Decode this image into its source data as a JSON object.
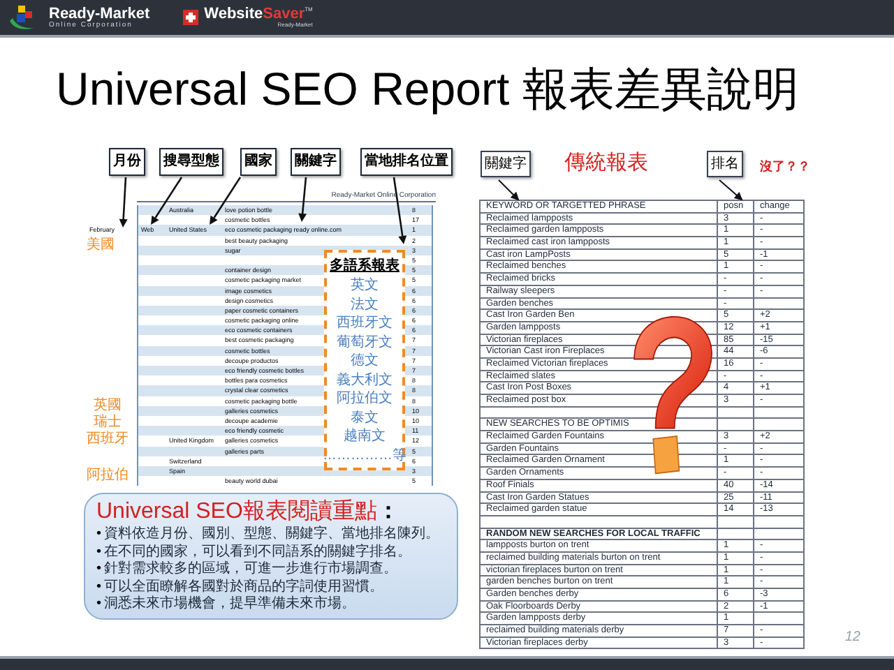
{
  "header": {
    "logos": [
      {
        "kind": "ready",
        "name": "Ready-Market",
        "subtext": "Online Corporation"
      },
      {
        "kind": "saver",
        "name": "Website",
        "accent": "Saver",
        "subtext": "Ready-Market",
        "mark": "TM"
      }
    ]
  },
  "title": "Universal SEO Report 報表差異說明",
  "left": {
    "labels": [
      "月份",
      "搜尋型態",
      "國家",
      "關鍵字",
      "當地排名位置"
    ],
    "report": {
      "company": "Ready-Market Online Corporation",
      "rows": [
        {
          "country": "Australia",
          "keyword": "love potion bottle",
          "rank": "8"
        },
        {
          "keyword": "cosmetic bottles",
          "rank": "17"
        },
        {
          "month": "February",
          "type": "Web",
          "country": "United States",
          "keyword": "eco cosmetic packaging ready online.com",
          "rank": "1"
        },
        {
          "keyword": "best beauty packaging",
          "rank": "2"
        },
        {
          "keyword": "sugar",
          "rank": "3"
        },
        {
          "rank": "5"
        },
        {
          "keyword": "container design",
          "rank": "5"
        },
        {
          "keyword": "cosmetic packaging market",
          "rank": "5"
        },
        {
          "keyword": "image cosmetics",
          "rank": "6"
        },
        {
          "keyword": "design cosmetics",
          "rank": "6"
        },
        {
          "keyword": "paper cosmetic containers",
          "rank": "6"
        },
        {
          "keyword": "cosmetic packaging online",
          "rank": "6"
        },
        {
          "keyword": "eco cosmetic containers",
          "rank": "6"
        },
        {
          "keyword": "best cosmetic packaging",
          "rank": "7"
        },
        {
          "keyword": "cosmetic bottles",
          "rank": "7"
        },
        {
          "keyword": "decoupe productos",
          "rank": "7"
        },
        {
          "keyword": "eco friendly cosmetic bottles",
          "rank": "7"
        },
        {
          "keyword": "bottles para cosmetics",
          "rank": "8"
        },
        {
          "keyword": "crystal clear cosmetics",
          "rank": "8"
        },
        {
          "keyword": "cosmetic packaging bottle",
          "rank": "8"
        },
        {
          "keyword": "galleries cosmetics",
          "rank": "10"
        },
        {
          "keyword": "decoupe academie",
          "rank": "10"
        },
        {
          "keyword": "eco friendly cosmetic",
          "rank": "11"
        },
        {
          "country": "United Kingdom",
          "keyword": "galleries cosmetics",
          "rank": "12"
        },
        {
          "keyword": "galleries parts",
          "rank": "5"
        },
        {
          "country": "Switzerland",
          "rank": "6"
        },
        {
          "country": "Spain",
          "rank": "3"
        },
        {
          "keyword": "beauty world dubai",
          "rank": "5"
        }
      ]
    },
    "region_labels": [
      {
        "lines": [
          "美國"
        ]
      },
      {
        "lines": [
          "英國",
          "瑞士",
          "西班牙"
        ]
      },
      {
        "lines": [
          "阿拉伯"
        ]
      }
    ],
    "language_box": {
      "title": "多語系報表",
      "languages": [
        "英文",
        "法文",
        "西班牙文",
        "葡萄牙文",
        "德文",
        "義大利文",
        "阿拉伯文",
        "泰文",
        "越南文"
      ],
      "more": "……………等"
    },
    "callout": {
      "title": "Universal SEO報表閱讀重點",
      "colon": "：",
      "points": [
        {
          "bullet": "•",
          "text": "資料依造月份、國別、型態、關鍵字、當地排名陳列。"
        },
        {
          "bullet": "•",
          "text": "在不同的國家，可以看到不同語系的關鍵字排名。"
        },
        {
          "bullet": "•",
          "text": "針對需求較多的區域，可進一步進行市場調查。"
        },
        {
          "bullet": "•",
          "text": "可以全面瞭解各國對於商品的字詞使用習慣。"
        },
        {
          "bullet": "•",
          "text": "洞悉未來市場機會，提早準備未來市場。"
        }
      ]
    }
  },
  "right": {
    "labels": [
      {
        "kind": "box",
        "text": "關鍵字"
      },
      {
        "kind": "heading",
        "text": "傳統報表"
      },
      {
        "kind": "box",
        "text": "排名"
      },
      {
        "kind": "note",
        "text": "沒了？？"
      }
    ],
    "table": {
      "columns": [
        "KEYWORD OR TARGETTED PHRASE",
        "posn",
        "change"
      ],
      "rows": [
        {
          "kind": "row",
          "cells": [
            "Reclaimed lampposts",
            "3",
            "-"
          ]
        },
        {
          "kind": "row",
          "cells": [
            "Reclaimed garden lampposts",
            "1",
            "-"
          ]
        },
        {
          "kind": "row",
          "cells": [
            "Reclaimed cast iron lampposts",
            "1",
            "-"
          ]
        },
        {
          "kind": "row",
          "cells": [
            "Cast iron LampPosts",
            "5",
            "-1"
          ]
        },
        {
          "kind": "row",
          "cells": [
            "Reclaimed benches",
            "1",
            "-"
          ]
        },
        {
          "kind": "row",
          "cells": [
            "Reclaimed bricks",
            "-",
            "-"
          ]
        },
        {
          "kind": "row",
          "cells": [
            "Railway sleepers",
            "-",
            "-"
          ]
        },
        {
          "kind": "row",
          "cells": [
            "Garden benches",
            "-",
            ""
          ]
        },
        {
          "kind": "row",
          "cells": [
            "Cast Iron Garden Ben",
            "5",
            "+2"
          ]
        },
        {
          "kind": "row",
          "cells": [
            "Garden lampposts",
            "12",
            "+1"
          ]
        },
        {
          "kind": "row",
          "cells": [
            "Victorian fireplaces",
            "85",
            "-15"
          ]
        },
        {
          "kind": "row",
          "cells": [
            "Victorian Cast iron Fireplaces",
            "44",
            "-6"
          ]
        },
        {
          "kind": "row",
          "cells": [
            "Reclaimed Victorian fireplaces",
            "16",
            "-"
          ]
        },
        {
          "kind": "row",
          "cells": [
            "Reclaimed slates",
            "-",
            "-"
          ]
        },
        {
          "kind": "row",
          "cells": [
            "Cast Iron Post Boxes",
            "4",
            "+1"
          ]
        },
        {
          "kind": "row",
          "cells": [
            "Reclaimed post box",
            "3",
            "-"
          ]
        },
        {
          "kind": "blank"
        },
        {
          "kind": "section",
          "cells": [
            "NEW SEARCHES TO BE OPTIMIS"
          ]
        },
        {
          "kind": "row",
          "cells": [
            "Reclaimed Garden Fountains",
            "3",
            "+2"
          ]
        },
        {
          "kind": "row",
          "cells": [
            "Garden Fountains",
            "-",
            "-"
          ]
        },
        {
          "kind": "row",
          "cells": [
            "Reclaimed Garden Ornament",
            "1",
            "-"
          ]
        },
        {
          "kind": "row",
          "cells": [
            "Garden Ornaments",
            "-",
            "-"
          ]
        },
        {
          "kind": "row",
          "cells": [
            "Roof Finials",
            "40",
            "-14"
          ]
        },
        {
          "kind": "row",
          "cells": [
            "Cast Iron Garden Statues",
            "25",
            "-11"
          ]
        },
        {
          "kind": "row",
          "cells": [
            "Reclaimed garden statue",
            "14",
            "-13"
          ]
        },
        {
          "kind": "blank"
        },
        {
          "kind": "heading",
          "cells": [
            "RANDOM NEW SEARCHES FOR LOCAL TRAFFIC"
          ]
        },
        {
          "kind": "row",
          "cells": [
            "lampposts burton on trent",
            "1",
            "-"
          ]
        },
        {
          "kind": "row",
          "cells": [
            "reclaimed building materials burton on trent",
            "1",
            "-"
          ]
        },
        {
          "kind": "row",
          "cells": [
            "victorian fireplaces burton on trent",
            "1",
            "-"
          ]
        },
        {
          "kind": "row",
          "cells": [
            "garden benches burton on trent",
            "1",
            "-"
          ]
        },
        {
          "kind": "row",
          "cells": [
            "Garden benches derby",
            "6",
            "-3"
          ]
        },
        {
          "kind": "row",
          "cells": [
            "Oak Floorboards Derby",
            "2",
            "-1"
          ]
        },
        {
          "kind": "row",
          "cells": [
            "Garden lampposts derby",
            "1",
            ""
          ]
        },
        {
          "kind": "row",
          "cells": [
            "reclaimed building materials derby",
            "7",
            "-"
          ]
        },
        {
          "kind": "row",
          "cells": [
            "Victorian fireplaces derby",
            "3",
            "-"
          ]
        }
      ]
    }
  },
  "page_number": "12"
}
